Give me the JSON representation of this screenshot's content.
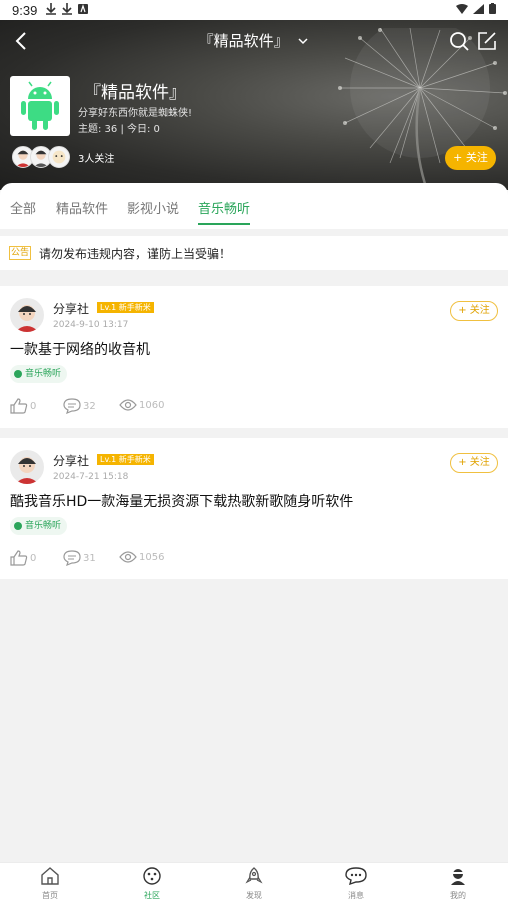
{
  "status_bar": {
    "time": "9:39"
  },
  "header": {
    "title": "『精品软件』",
    "forum_name": "『精品软件』",
    "forum_desc": "分享好东西你就是蜘蛛侠!",
    "stats": "主题: 36 | 今日: 0",
    "followers_text": "3人关注",
    "follow_label": "+ 关注"
  },
  "tabs": [
    {
      "label": "全部"
    },
    {
      "label": "精品软件"
    },
    {
      "label": "影视小说"
    },
    {
      "label": "音乐畅听"
    }
  ],
  "active_tab": "音乐畅听",
  "notice": {
    "tag": "公告",
    "text": "请勿发布违规内容，谨防上当受骗！"
  },
  "posts": [
    {
      "author": "分享社",
      "level": "Lv.1 新手新米",
      "date": "2024-9-10 13:17",
      "follow_label": "+ 关注",
      "title": "一款基于网络的收音机",
      "category": "音乐畅听",
      "likes": "0",
      "comments": "32",
      "views": "1060"
    },
    {
      "author": "分享社",
      "level": "Lv.1 新手新米",
      "date": "2024-7-21 15:18",
      "follow_label": "+ 关注",
      "title": "酷我音乐HD一款海量无损资源下载热歌新歌随身听软件",
      "category": "音乐畅听",
      "likes": "0",
      "comments": "31",
      "views": "1056"
    }
  ],
  "bottom_nav": [
    {
      "label": "首页",
      "icon": "home-icon"
    },
    {
      "label": "社区",
      "icon": "community-icon"
    },
    {
      "label": "发现",
      "icon": "rocket-icon"
    },
    {
      "label": "消息",
      "icon": "message-icon"
    },
    {
      "label": "我的",
      "icon": "profile-icon"
    }
  ],
  "colors": {
    "accent": "#2aa55a",
    "follow": "#f5b400"
  }
}
